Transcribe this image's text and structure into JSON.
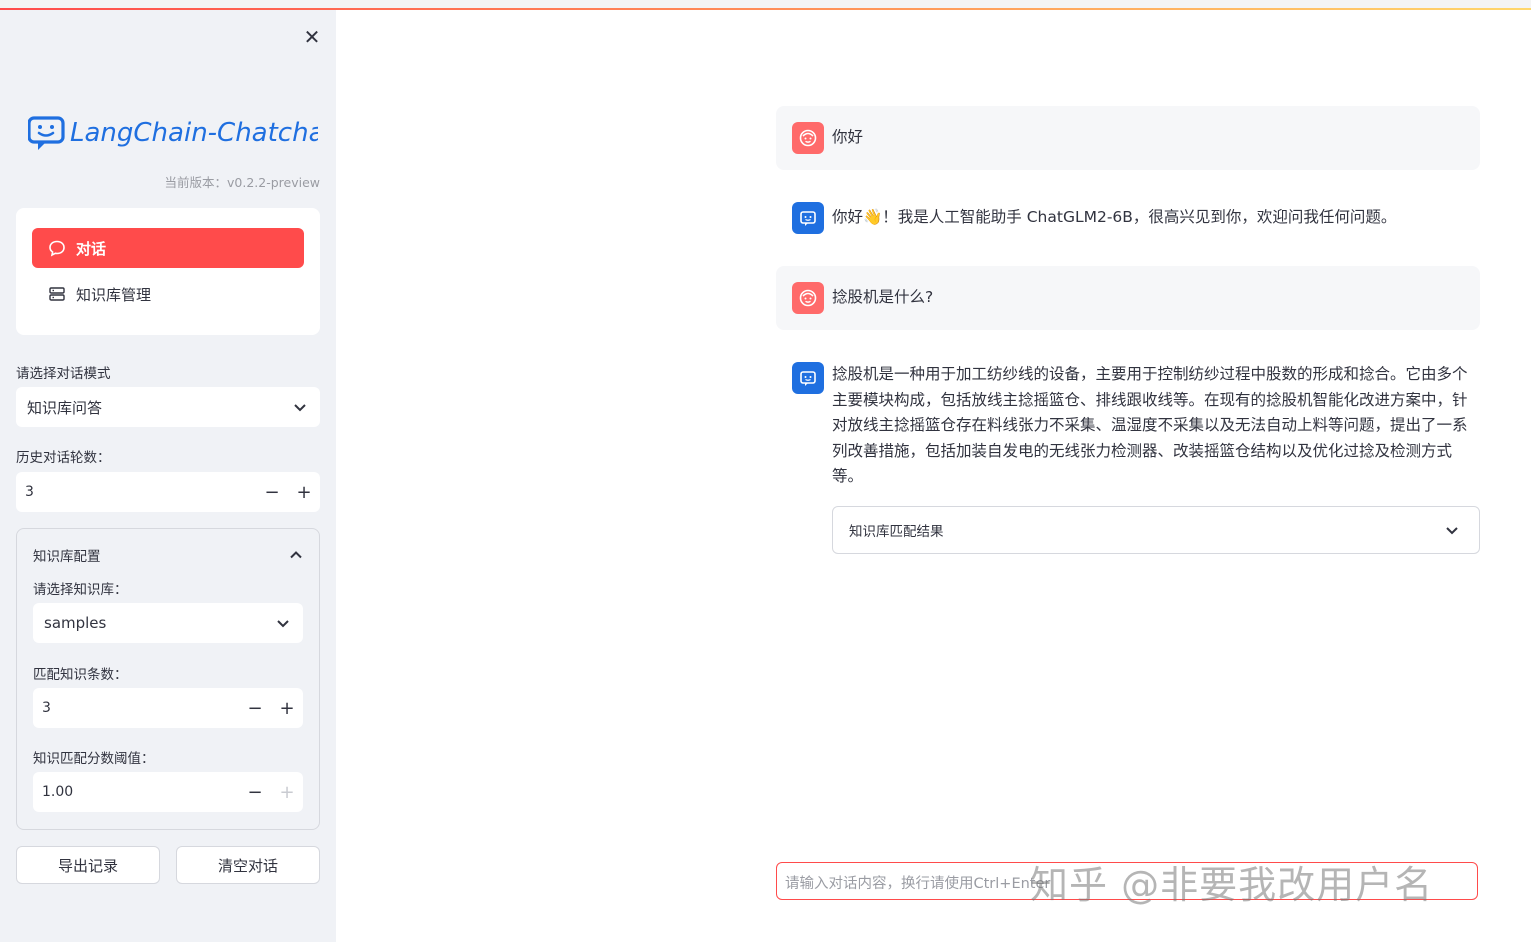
{
  "colors": {
    "primary": "#ff4b4b",
    "sidebar_bg": "#f0f2f6",
    "bot_avatar": "#1f6fe0",
    "user_avatar": "#ff6a6a"
  },
  "sidebar": {
    "close_icon": "close-icon",
    "logo_text": "LangChain-Chatchat",
    "version": "当前版本：v0.2.2-preview",
    "nav": [
      {
        "label": "对话",
        "icon": "chat-bubble-icon",
        "active": true
      },
      {
        "label": "知识库管理",
        "icon": "database-icon",
        "active": false
      }
    ],
    "mode": {
      "label": "请选择对话模式",
      "value": "知识库问答"
    },
    "history": {
      "label": "历史对话轮数：",
      "value": "3"
    },
    "kb_config": {
      "title": "知识库配置",
      "kb_select": {
        "label": "请选择知识库：",
        "value": "samples"
      },
      "topk": {
        "label": "匹配知识条数：",
        "value": "3"
      },
      "threshold": {
        "label": "知识匹配分数阈值：",
        "value": "1.00"
      }
    },
    "buttons": {
      "export": "导出记录",
      "clear": "清空对话"
    }
  },
  "chat": {
    "messages": [
      {
        "role": "user",
        "text": "你好"
      },
      {
        "role": "assistant",
        "text": "你好👋！我是人工智能助手 ChatGLM2-6B，很高兴见到你，欢迎问我任何问题。"
      },
      {
        "role": "user",
        "text": "捻股机是什么?"
      },
      {
        "role": "assistant",
        "text": "捻股机是一种用于加工纺纱线的设备，主要用于控制纺纱过程中股数的形成和捻合。它由多个主要模块构成，包括放线主捻摇篮仓、排线跟收线等。在现有的捻股机智能化改进方案中，针对放线主捻摇篮仓存在料线张力不采集、温湿度不采集以及无法自动上料等问题，提出了一系列改善措施，包括加装自发电的无线张力检测器、改装摇篮仓结构以及优化过捻及检测方式等。"
      }
    ],
    "expander_label": "知识库匹配结果",
    "input_placeholder": "请输入对话内容，换行请使用Ctrl+Enter",
    "watermark": "知乎 @非要我改用户名"
  }
}
